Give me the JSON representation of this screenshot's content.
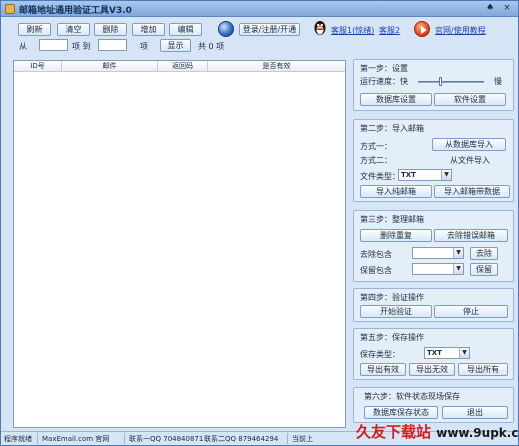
{
  "window": {
    "title": "邮箱地址通用验证工具V3.0"
  },
  "toolbar": {
    "refresh": "刷新",
    "clear": "清空",
    "delete": "删除",
    "add": "增加",
    "edit": "编辑",
    "login": "登录/注册/开通",
    "service1": "客服1(惊绪)",
    "service2": "客服2",
    "website": "官网/使用教程"
  },
  "range": {
    "from_label": "从",
    "item_label1": "项 到",
    "item_label2": "项",
    "show": "显示",
    "total": "共 0 项",
    "from_value": "",
    "to_value": ""
  },
  "table": {
    "columns": [
      "ID号",
      "邮件",
      "返回码",
      "是否有效"
    ]
  },
  "step1": {
    "title": "第一步：设置",
    "speed_label": "运行速度：快",
    "slow": "慢",
    "speed_level": 0.35,
    "db_settings": "数据库设置",
    "sw_settings": "软件设置"
  },
  "step2": {
    "title": "第二步：导入邮箱",
    "method1": "方式一：",
    "from_db": "从数据库导入",
    "method2": "方式二：",
    "from_file": "从文件导入",
    "file_type_label": "文件类型：",
    "file_type": "TXT",
    "import_mail": "导入纯邮箱",
    "import_mail_pwd": "导入邮箱带数据"
  },
  "step3": {
    "title": "第三步：整理邮箱",
    "dedupe": "删除重复",
    "remove_invalid": "去除错误邮箱",
    "remove_contains": "去除包含",
    "remove_btn": "去除",
    "keep_contains": "保留包含",
    "keep_btn": "保留"
  },
  "step4": {
    "title": "第四步：验证操作",
    "start": "开始验证",
    "stop": "停止"
  },
  "step5": {
    "title": "第五步：保存操作",
    "save_type_label": "保存类型：",
    "save_type": "TXT",
    "export_valid": "导出有效",
    "export_invalid": "导出无效",
    "export_all": "导出所有"
  },
  "step6": {
    "title": "第六步：软件状态现场保存",
    "save_state": "数据库保存状态",
    "exit": "退出"
  },
  "status": {
    "ready": "程序就绪",
    "site": "MaxEmail.com 官网",
    "qq1": "联系一QQ 704840871",
    "qq2": "联系二QQ 879464294",
    "current": "当前上"
  },
  "watermark": {
    "text": "久友下载站",
    "url": "www.9upk.com"
  }
}
